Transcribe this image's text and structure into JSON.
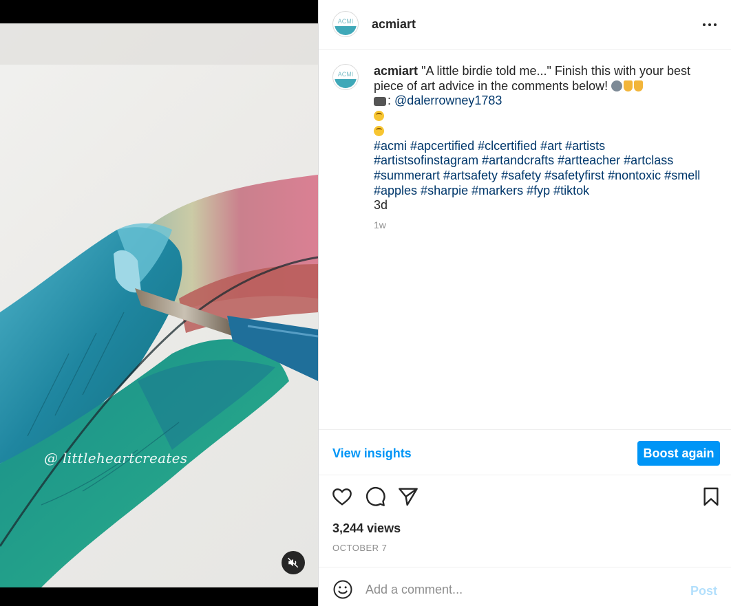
{
  "media": {
    "watermark": "@ littleheartcreates",
    "mute_icon": "speaker-muted-icon"
  },
  "header": {
    "username": "acmiart",
    "avatar_text": "ACMI",
    "more_icon": "more-horizontal-icon"
  },
  "caption": {
    "username": "acmiart",
    "text_line1": "\"A little birdie told me...\" Finish this with your best",
    "text_line2": "piece of art advice in the comments below!",
    "credit_prefix": ":",
    "credit_handle": "@dalerrowney1783",
    "hashtag_lines": [
      "#acmi #apcertified #clcertified #art #artists",
      "#artistsofinstagram #artandcrafts #artteacher #artclass",
      "#summerart #artsafety #safety #safetyfirst #nontoxic #smell",
      "#apples #sharpie #markers #fyp #tiktok"
    ],
    "extra_line": "3d",
    "time": "1w"
  },
  "insights": {
    "view_label": "View insights",
    "boost_label": "Boost again"
  },
  "actions": {
    "like_icon": "heart-icon",
    "comment_icon": "comment-icon",
    "share_icon": "send-icon",
    "save_icon": "bookmark-icon"
  },
  "stats": {
    "views": "3,244 views",
    "date": "OCTOBER 7"
  },
  "comment": {
    "placeholder": "Add a comment...",
    "post_label": "Post",
    "emoji_icon": "smiley-icon"
  },
  "colors": {
    "accent": "#0095f6",
    "link": "#00376b",
    "muted": "#8e8e8e",
    "post_disabled": "#b2dffc"
  }
}
